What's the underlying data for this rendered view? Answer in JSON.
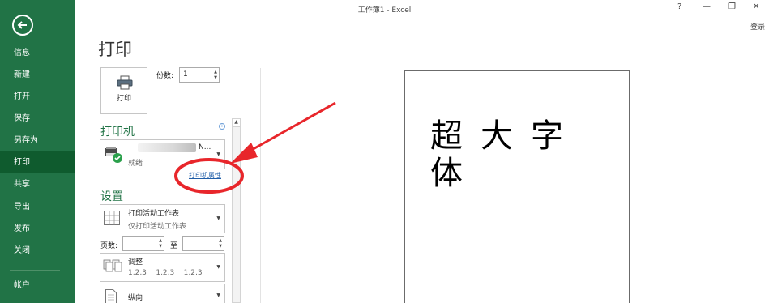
{
  "window": {
    "title": "工作簿1 - Excel",
    "help": "?",
    "minimize": "—",
    "restore": "❐",
    "close": "✕",
    "login": "登录"
  },
  "sidebar": {
    "items": [
      {
        "label": "信息"
      },
      {
        "label": "新建"
      },
      {
        "label": "打开"
      },
      {
        "label": "保存"
      },
      {
        "label": "另存为"
      },
      {
        "label": "打印",
        "active": true
      },
      {
        "label": "共享"
      },
      {
        "label": "导出"
      },
      {
        "label": "发布"
      },
      {
        "label": "关闭"
      },
      {
        "label": "帐户"
      }
    ]
  },
  "print": {
    "title": "打印",
    "button_label": "打印",
    "copies_label": "份数:",
    "copies_value": "1"
  },
  "printer": {
    "heading": "打印机",
    "name_suffix": "N...",
    "status": "就绪",
    "properties_link": "打印机属性"
  },
  "settings": {
    "heading": "设置",
    "scope_title": "打印活动工作表",
    "scope_sub": "仅打印活动工作表",
    "pages_label": "页数:",
    "to_label": "至",
    "collate_title": "调整",
    "collate_sub": "1,2,3    1,2,3    1,2,3",
    "orientation": "纵向"
  },
  "preview": {
    "text": "超大字体"
  },
  "colors": {
    "sidebar": "#217346",
    "sidebar_active": "#0f5b2e",
    "accent": "#217346",
    "annotation": "#e8262b",
    "link": "#1f5da8"
  }
}
